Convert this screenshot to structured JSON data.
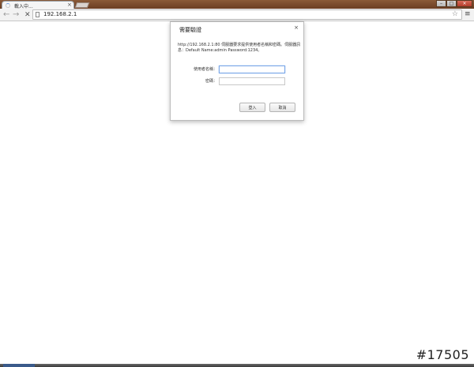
{
  "browser": {
    "tab_title": "載入中...",
    "tab_close": "×",
    "url": "192.168.2.1",
    "icons": {
      "back": "back-arrow-icon",
      "forward": "forward-arrow-icon",
      "stop": "stop-icon",
      "star": "star-icon",
      "menu": "menu-icon"
    }
  },
  "dialog": {
    "title": "需要驗證",
    "close": "×",
    "message": "http://192.168.2.1:80 伺服器要求提供使用者名稱和密碼。伺服器訊息：Default Name:admin Password:1234。",
    "username_label": "使用者名稱：",
    "username_value": "",
    "password_label": "密碼：",
    "password_value": "",
    "login_button": "登入",
    "cancel_button": "取消"
  },
  "watermark": "#17505",
  "colors": {
    "titlebar": "#6b3d22",
    "focus_border": "#7aa7e8"
  }
}
